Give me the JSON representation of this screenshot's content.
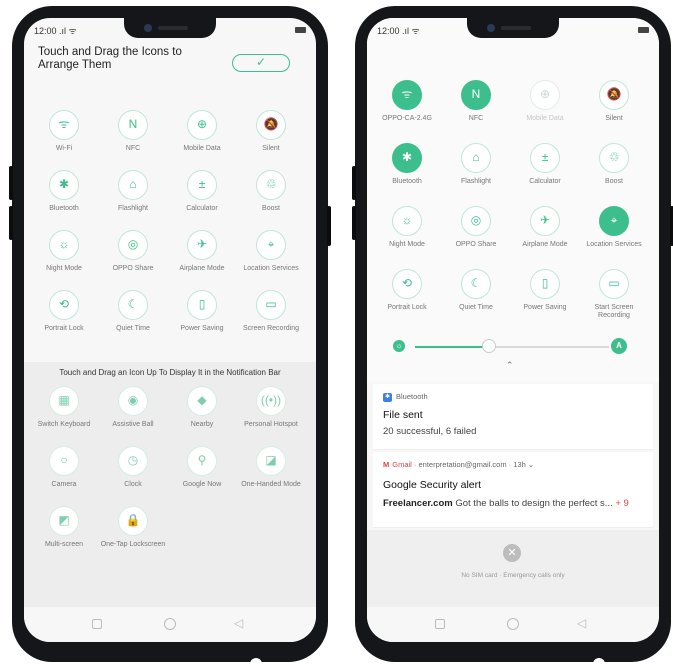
{
  "left_phone": {
    "status": {
      "time": "12:00 .ıl ᯤ"
    },
    "header": {
      "title": "Touch and Drag the Icons to Arrange Them",
      "done_label": "✓"
    },
    "active_tiles": [
      {
        "label": "Wi-Fi",
        "glyph": "ᯤ",
        "icon": "wifi-icon"
      },
      {
        "label": "NFC",
        "glyph": "N",
        "icon": "nfc-icon"
      },
      {
        "label": "Mobile Data",
        "glyph": "⊕",
        "icon": "mobile-data-icon"
      },
      {
        "label": "Silent",
        "glyph": "🔕",
        "icon": "silent-icon"
      },
      {
        "label": "Bluetooth",
        "glyph": "✱",
        "icon": "bluetooth-icon"
      },
      {
        "label": "Flashlight",
        "glyph": "⌂",
        "icon": "flashlight-icon"
      },
      {
        "label": "Calculator",
        "glyph": "±",
        "icon": "calculator-icon"
      },
      {
        "label": "Boost",
        "glyph": "♲",
        "icon": "boost-icon"
      },
      {
        "label": "Night Mode",
        "glyph": "☼",
        "icon": "night-mode-icon"
      },
      {
        "label": "OPPO Share",
        "glyph": "◎",
        "icon": "oppo-share-icon"
      },
      {
        "label": "Airplane Mode",
        "glyph": "✈",
        "icon": "airplane-icon"
      },
      {
        "label": "Location Services",
        "glyph": "⌖",
        "icon": "location-icon"
      },
      {
        "label": "Portrait Lock",
        "glyph": "⟲",
        "icon": "portrait-lock-icon"
      },
      {
        "label": "Quiet Time",
        "glyph": "☾",
        "icon": "quiet-time-icon"
      },
      {
        "label": "Power Saving",
        "glyph": "▯",
        "icon": "power-saving-icon"
      },
      {
        "label": "Screen Recording",
        "glyph": "▭",
        "icon": "screen-recording-icon"
      }
    ],
    "section_title": "Touch and Drag an Icon Up To Display It in the Notification Bar",
    "extra_tiles": [
      {
        "label": "Switch Keyboard",
        "glyph": "▦",
        "icon": "switch-keyboard-icon"
      },
      {
        "label": "Assistive Ball",
        "glyph": "◉",
        "icon": "assistive-ball-icon"
      },
      {
        "label": "Nearby",
        "glyph": "◆",
        "icon": "nearby-icon"
      },
      {
        "label": "Personal Hotspot",
        "glyph": "((•))",
        "icon": "hotspot-icon"
      },
      {
        "label": "Camera",
        "glyph": "○",
        "icon": "camera-icon"
      },
      {
        "label": "Clock",
        "glyph": "◷",
        "icon": "clock-icon"
      },
      {
        "label": "Google Now",
        "glyph": "⚲",
        "icon": "google-now-icon"
      },
      {
        "label": "One-Handed Mode",
        "glyph": "◪",
        "icon": "one-handed-icon"
      },
      {
        "label": "Multi-screen",
        "glyph": "◩",
        "icon": "multi-screen-icon"
      },
      {
        "label": "One-Tap Lockscreen",
        "glyph": "🔒",
        "icon": "lock-icon"
      }
    ],
    "nav": {
      "recent": "□",
      "home": "○",
      "back": "◁"
    }
  },
  "right_phone": {
    "status": {
      "time": "12:00 .ıl ᯤ"
    },
    "tiles": [
      {
        "label": "OPPO-CA-2.4G",
        "glyph": "ᯤ",
        "icon": "wifi-icon",
        "state": "on"
      },
      {
        "label": "NFC",
        "glyph": "N",
        "icon": "nfc-icon",
        "state": "on"
      },
      {
        "label": "Mobile Data",
        "glyph": "⊕",
        "icon": "mobile-data-icon",
        "state": "dim"
      },
      {
        "label": "Silent",
        "glyph": "🔕",
        "icon": "silent-icon",
        "state": "off"
      },
      {
        "label": "Bluetooth",
        "glyph": "✱",
        "icon": "bluetooth-icon",
        "state": "on"
      },
      {
        "label": "Flashlight",
        "glyph": "⌂",
        "icon": "flashlight-icon",
        "state": "off"
      },
      {
        "label": "Calculator",
        "glyph": "±",
        "icon": "calculator-icon",
        "state": "off"
      },
      {
        "label": "Boost",
        "glyph": "♲",
        "icon": "boost-icon",
        "state": "off"
      },
      {
        "label": "Night Mode",
        "glyph": "☼",
        "icon": "night-mode-icon",
        "state": "off"
      },
      {
        "label": "OPPO Share",
        "glyph": "◎",
        "icon": "oppo-share-icon",
        "state": "off"
      },
      {
        "label": "Airplane Mode",
        "glyph": "✈",
        "icon": "airplane-icon",
        "state": "off"
      },
      {
        "label": "Location Services",
        "glyph": "⌖",
        "icon": "location-icon",
        "state": "on"
      },
      {
        "label": "Portrait Lock",
        "glyph": "⟲",
        "icon": "portrait-lock-icon",
        "state": "off"
      },
      {
        "label": "Quiet Time",
        "glyph": "☾",
        "icon": "quiet-time-icon",
        "state": "off"
      },
      {
        "label": "Power Saving",
        "glyph": "▯",
        "icon": "power-saving-icon",
        "state": "off"
      },
      {
        "label": "Start Screen Recording",
        "glyph": "▭",
        "icon": "screen-recording-icon",
        "state": "off"
      }
    ],
    "brightness": {
      "level": 0.38,
      "sun": "☼",
      "auto": "A",
      "collapse": "⌃"
    },
    "notifications": [
      {
        "app": "Bluetooth",
        "app_glyph": "✱",
        "title": "File sent",
        "body": "20 successful, 6 failed"
      },
      {
        "app": "Gmail",
        "app_glyph": "M",
        "meta": " · enterpretation@gmail.com · 13h ⌄",
        "title": "Google Security alert",
        "body_sender": "Freelancer.com",
        "body_text": " Got the balls to design the perfect s...",
        "more": "+ 9"
      }
    ],
    "no_sim": {
      "icon": "✕",
      "text": "No SIM card · Emergency calls only"
    },
    "nav": {
      "recent": "□",
      "home": "○",
      "back": "◁"
    }
  },
  "colors": {
    "accent": "#3cbf8c",
    "gmail": "#dd4444"
  }
}
